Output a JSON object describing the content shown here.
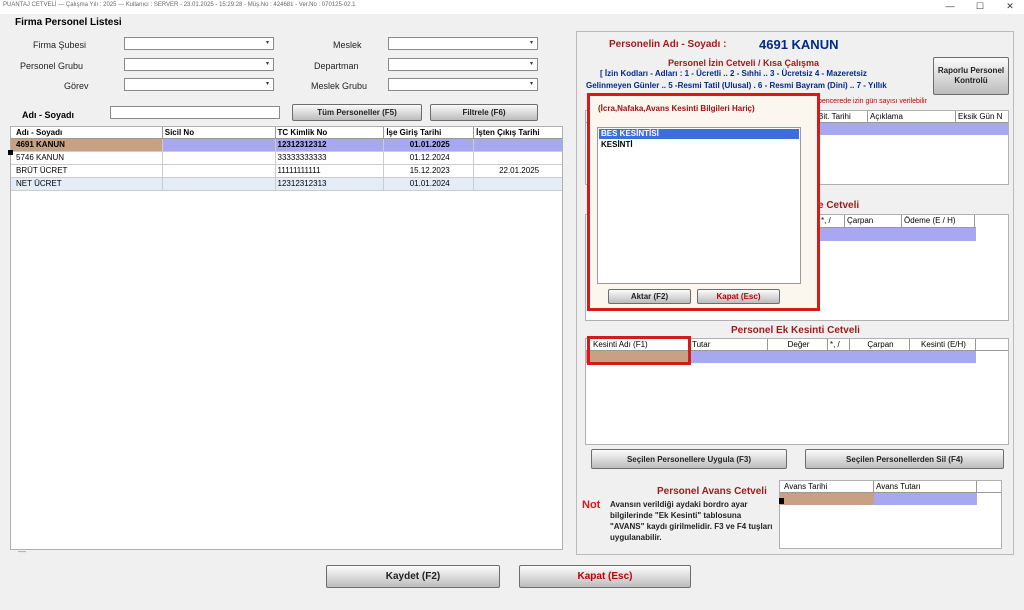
{
  "titlebar": {
    "text": "PUANTAJ CETVELİ  ---  Çalışma Yılı : 2025  ---  Kullanıcı : SERVER - 23.01.2025 - 15:29:28 - Müş.No : 424681 - Ver.No : 070125-02.1",
    "minimize": "—",
    "maximize": "☐",
    "close": "✕"
  },
  "left": {
    "title": "Firma Personel Listesi",
    "filters": {
      "firma_subesi": "Firma Şubesi",
      "personel_grubu": "Personel Grubu",
      "gorev": "Görev",
      "meslek": "Meslek",
      "departman": "Departman",
      "meslek_grubu": "Meslek Grubu"
    },
    "name_label": "Adı - Soyadı",
    "name_value": "",
    "btn_all": "Tüm Personeller (F5)",
    "btn_filter": "Filtrele (F6)",
    "grid": {
      "headers": [
        "Adı - Soyadı",
        "Sicil No",
        "TC Kimlik No",
        "İşe Giriş Tarihi",
        "İşten Çıkış Tarihi"
      ],
      "rows": [
        {
          "name": "4691 KANUN",
          "sicil": "",
          "tc": "12312312312",
          "giris": "01.01.2025",
          "cikis": ""
        },
        {
          "name": "5746 KANUN",
          "sicil": "",
          "tc": "33333333333",
          "giris": "01.12.2024",
          "cikis": ""
        },
        {
          "name": "BRÜT ÜCRET",
          "sicil": "",
          "tc": "11111111111",
          "giris": "15.12.2023",
          "cikis": "22.01.2025"
        },
        {
          "name": "NET ÜCRET",
          "sicil": "",
          "tc": "12312312313",
          "giris": "01.01.2024",
          "cikis": ""
        }
      ]
    },
    "bottom_mark": "—"
  },
  "right": {
    "personel_label": "Personelin Adı - Soyadı :",
    "personel_value": "4691 KANUN",
    "izin_title": "Personel İzin Cetveli / Kısa Çalışma",
    "izin_codes_1": "[ İzin Kodları - Adları : 1 - Ücretli .. 2 - Sıhhi  .. 3 - Ücretsiz  4 - Mazeretsiz",
    "izin_codes_2": "Gelinmeyen Günler .. 5 -Resmi Tatil  (Ulusal) . 6 - Resmi Bayram (Dini) .. 7 - Yıllık",
    "izin_note": "pencerede izin gün sayısı verilebilir",
    "izin_cols": [
      "Bit. Tarihi",
      "Açıklama",
      "Eksik Gün N"
    ],
    "raporlu_btn": "Raporlu Personel Kontrolü",
    "odeme_title": "e Cetveli",
    "odeme_cols": [
      "*, /",
      "Çarpan",
      "Ödeme (E / H)"
    ],
    "ek_title": "Personel Ek Kesinti Cetveli",
    "ek_cols": [
      "Kesinti Adı (F1)",
      "Tutar",
      "Değer",
      "*, /",
      "Çarpan",
      "Kesinti (E/H)"
    ],
    "btn_apply": "Seçilen Personellere Uygula (F3)",
    "btn_delete": "Seçilen Personellerden Sil (F4)",
    "not_label": "Not",
    "avans_title": "Personel Avans Cetveli",
    "avans_note": "Avansın verildiği aydaki bordro ayar bilgilerinde \"Ek Kesinti\" tablosuna \"AVANS\" kaydı girilmelidir. F3 ve F4 tuşları uygulanabilir.",
    "avans_cols": [
      "Avans Tarihi",
      "Avans Tutarı"
    ]
  },
  "popup": {
    "title": "(İcra,Nafaka,Avans Kesinti Bilgileri Hariç)",
    "items": [
      "BES KESİNTİSİ",
      "KESİNTİ"
    ],
    "btn_transfer": "Aktar (F2)",
    "btn_close": "Kapat (Esc)"
  },
  "footer": {
    "save": "Kaydet (F2)",
    "close": "Kapat (Esc)"
  },
  "colors": {
    "selected_row": "#a8a8f0",
    "tan_cell": "#c8a084",
    "highlight": "#3d6fd9",
    "red_box": "#d61a1a"
  }
}
